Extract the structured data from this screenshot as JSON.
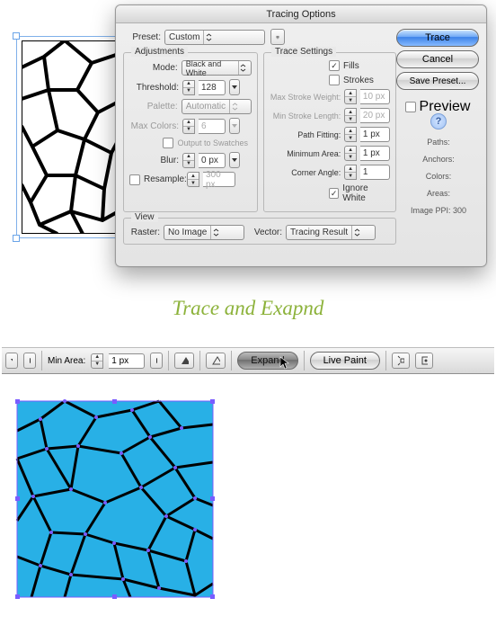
{
  "dialog": {
    "title": "Tracing Options",
    "preset_label": "Preset:",
    "preset_value": "Custom",
    "adjustments": {
      "group_title": "Adjustments",
      "mode_label": "Mode:",
      "mode_value": "Black and White",
      "threshold_label": "Threshold:",
      "threshold_value": "128",
      "palette_label": "Palette:",
      "palette_value": "Automatic",
      "maxcolors_label": "Max Colors:",
      "maxcolors_value": "6",
      "output_swatches_label": "Output to Swatches",
      "blur_label": "Blur:",
      "blur_value": "0 px",
      "resample_label": "Resample:",
      "resample_value": "300 px"
    },
    "trace_settings": {
      "group_title": "Trace Settings",
      "fills_label": "Fills",
      "fills_checked": true,
      "strokes_label": "Strokes",
      "strokes_checked": false,
      "max_stroke_weight_label": "Max Stroke Weight:",
      "max_stroke_weight_value": "10 px",
      "min_stroke_length_label": "Min Stroke Length:",
      "min_stroke_length_value": "20 px",
      "path_fitting_label": "Path Fitting:",
      "path_fitting_value": "1 px",
      "min_area_label": "Minimum Area:",
      "min_area_value": "1 px",
      "corner_angle_label": "Corner Angle:",
      "corner_angle_value": "1",
      "ignore_white_label": "Ignore White",
      "ignore_white_checked": true
    },
    "view": {
      "group_title": "View",
      "raster_label": "Raster:",
      "raster_value": "No Image",
      "vector_label": "Vector:",
      "vector_value": "Tracing Result"
    },
    "buttons": {
      "trace": "Trace",
      "cancel": "Cancel",
      "save_preset": "Save Preset...",
      "preview_label": "Preview"
    },
    "info": {
      "paths": "Paths:",
      "anchors": "Anchors:",
      "colors": "Colors:",
      "areas": "Areas:",
      "ppi": "Image PPI: 300"
    }
  },
  "caption": "Trace and Exapnd",
  "toolbar": {
    "min_area_label": "Min Area:",
    "min_area_value": "1 px",
    "expand_label": "Expand",
    "live_paint_label": "Live Paint"
  },
  "colors": {
    "selection": "#7fb0ea",
    "artwork_fill": "#28b0e6",
    "anchor": "#7a5cff"
  }
}
